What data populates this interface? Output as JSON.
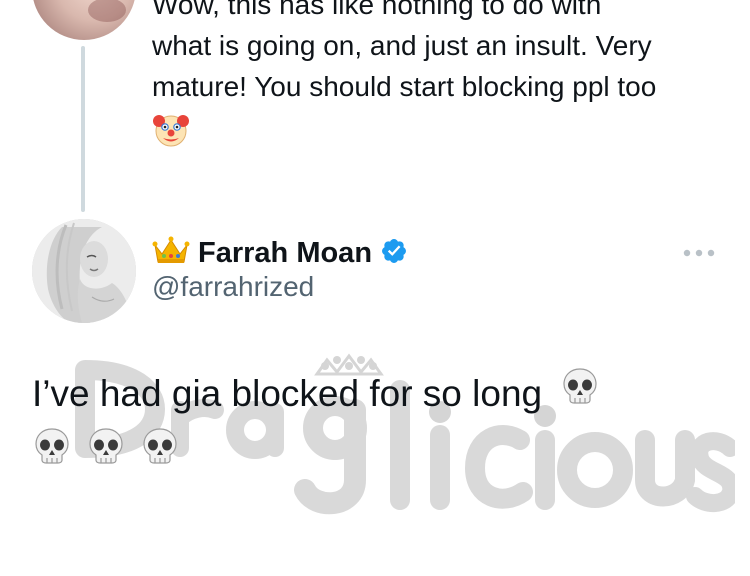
{
  "previous_tweet": {
    "line_cut": "Wow, this has like nothing to do with",
    "line1": "what is going on, and just an insult. Very",
    "line2": "mature! You should start blocking ppl too",
    "emoji_icon": "clown-face-icon"
  },
  "tweet": {
    "display_name": "Farrah Moan",
    "handle": "@farrahrized",
    "name_emoji_icon": "crown-icon",
    "verified": true,
    "text": "I’ve had gia blocked for so long",
    "trailing_emoji_icon": "skull-icon",
    "skull_count_line2": 3
  },
  "watermark": {
    "text": "Draglicious"
  },
  "colors": {
    "verified_blue": "#1d9bf0",
    "secondary_text": "#536471",
    "thread_line": "#cfd9de"
  }
}
